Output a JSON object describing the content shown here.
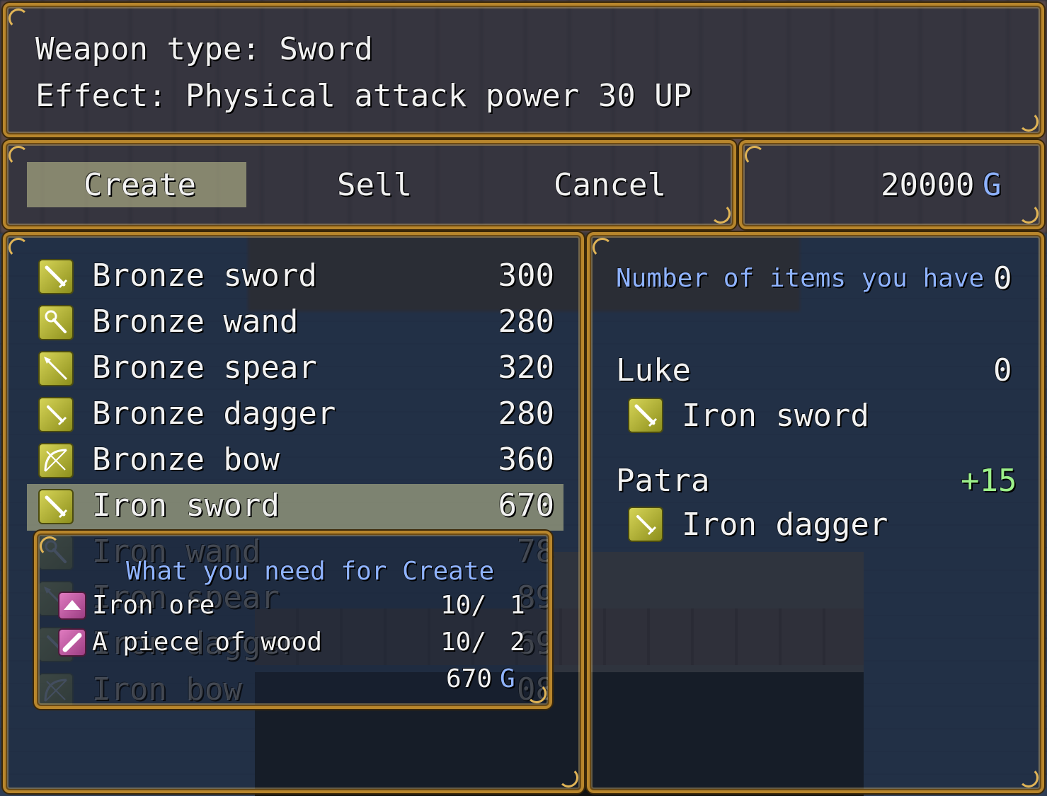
{
  "help": {
    "line1": "Weapon type: Sword",
    "line2": "Effect: Physical attack power 30 UP"
  },
  "commands": {
    "create": "Create",
    "sell": "Sell",
    "cancel": "Cancel"
  },
  "gold": {
    "amount": "20000",
    "unit": "G"
  },
  "items": [
    {
      "name": "Bronze sword",
      "price": "300",
      "icon": "sword-icon"
    },
    {
      "name": "Bronze wand",
      "price": "280",
      "icon": "wand-icon"
    },
    {
      "name": "Bronze spear",
      "price": "320",
      "icon": "spear-icon"
    },
    {
      "name": "Bronze dagger",
      "price": "280",
      "icon": "dagger-icon"
    },
    {
      "name": "Bronze bow",
      "price": "360",
      "icon": "bow-icon"
    },
    {
      "name": "Iron sword",
      "price": "670",
      "icon": "sword-icon"
    },
    {
      "name": "Iron wand",
      "price": "78",
      "icon": "wand-icon"
    },
    {
      "name": "Iron spear",
      "price": "89",
      "icon": "spear-icon"
    },
    {
      "name": "Iron dagger",
      "price": "69",
      "icon": "dagger-icon"
    },
    {
      "name": "Iron bow",
      "price": "08",
      "icon": "bow-icon"
    }
  ],
  "materials": {
    "title": "What you need for Create",
    "rows": [
      {
        "name": "Iron ore",
        "have": "10/",
        "need": "1",
        "icon": "ore-icon"
      },
      {
        "name": "A piece of wood",
        "have": "10/",
        "need": "2",
        "icon": "wood-icon"
      }
    ],
    "cost": "670",
    "cost_unit": "G"
  },
  "status": {
    "possession_label": "Number of items you have",
    "possession_value": "0",
    "actors": [
      {
        "name": "Luke",
        "change": "0",
        "equip": "Iron sword",
        "icon": "sword-icon"
      },
      {
        "name": "Patra",
        "change": "+15",
        "equip": "Iron dagger",
        "icon": "dagger-icon"
      }
    ]
  },
  "colors": {
    "frame": "#b8862c",
    "system_blue": "#8fb3ff",
    "power_up_green": "#9cf08a",
    "icon_olive": "#c5c33f"
  }
}
